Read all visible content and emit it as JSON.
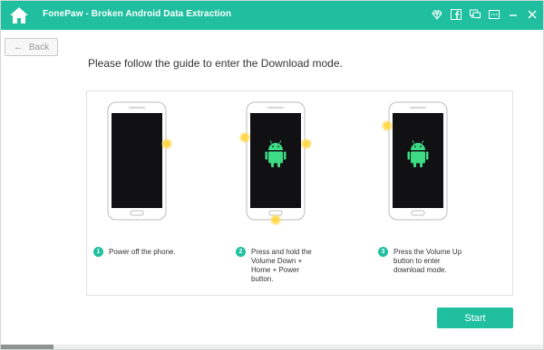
{
  "window": {
    "title": "FonePaw - Broken Android Data Extraction"
  },
  "titlebar_icons": [
    "home-icon",
    "diamond-icon",
    "facebook-icon",
    "chat-icon",
    "menu-icon",
    "minimize-icon",
    "close-icon"
  ],
  "nav": {
    "back_label": "Back"
  },
  "main": {
    "instruction": "Please follow the guide to enter the Download mode.",
    "steps": [
      {
        "number": "1",
        "text": "Power off the phone."
      },
      {
        "number": "2",
        "text": "Press and hold the Volume Down + Home + Power button."
      },
      {
        "number": "3",
        "text": "Press the Volume Up button to enter download mode."
      }
    ],
    "start_label": "Start"
  },
  "colors": {
    "accent": "#1fbf9f",
    "highlight": "#ffd84a",
    "screen": "#111114",
    "android": "#3ddc84"
  }
}
